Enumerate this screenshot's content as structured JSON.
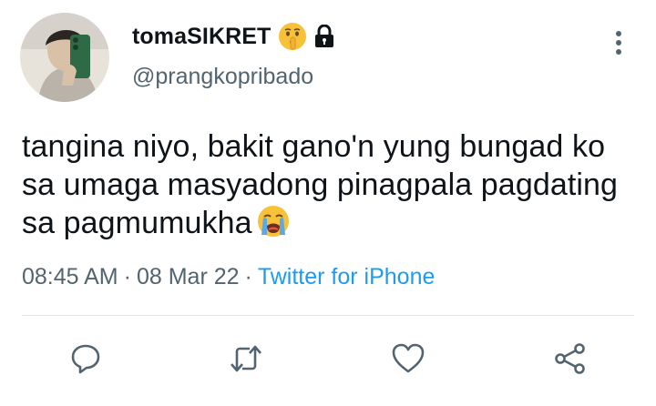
{
  "user": {
    "display_name": "tomaSIKRET",
    "handle": "@prangkopribado",
    "name_emoji_icon": "shushing-face-icon",
    "lock_icon": "lock-icon"
  },
  "tweet": {
    "text": "tangina niyo, bakit gano'n yung bungad ko sa umaga masyadong pinagpala pagdating sa pagmumukha",
    "trailing_emoji_icon": "loudly-crying-face-icon"
  },
  "meta": {
    "time": "08:45 AM",
    "separator": "·",
    "date": "08 Mar 22",
    "source": "Twitter for iPhone"
  },
  "actions": [
    "reply-icon",
    "retweet-icon",
    "like-icon",
    "share-icon"
  ],
  "colors": {
    "text": "#0f1419",
    "secondary": "#536471",
    "link": "#1d9bf0",
    "divider": "#e1e4e8"
  }
}
